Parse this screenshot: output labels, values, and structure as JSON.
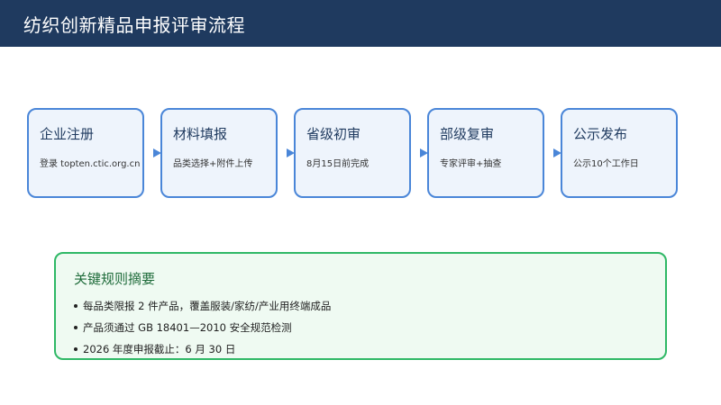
{
  "header": {
    "title": "纺织创新精品申报评审流程"
  },
  "steps": [
    {
      "title": "企业注册",
      "desc": "登录 topten.ctic.org.cn"
    },
    {
      "title": "材料填报",
      "desc": "品类选择+附件上传"
    },
    {
      "title": "省级初审",
      "desc": "8月15日前完成"
    },
    {
      "title": "部级复审",
      "desc": "专家评审+抽查"
    },
    {
      "title": "公示发布",
      "desc": "公示10个工作日"
    }
  ],
  "rules": {
    "title": "关键规则摘要",
    "items": [
      "每品类限报 2 件产品，覆盖服装/家纺/产业用终端成品",
      "产品须通过 GB 18401—2010 安全规范检测",
      "2026 年度申报截止：6 月 30 日"
    ]
  },
  "colors": {
    "header_bg": "#1f3a5f",
    "step_border": "#4a86d8",
    "step_bg": "#eef4fc",
    "rules_border": "#2fb866",
    "rules_bg": "#effaf2",
    "rules_title": "#1e6b3a"
  }
}
